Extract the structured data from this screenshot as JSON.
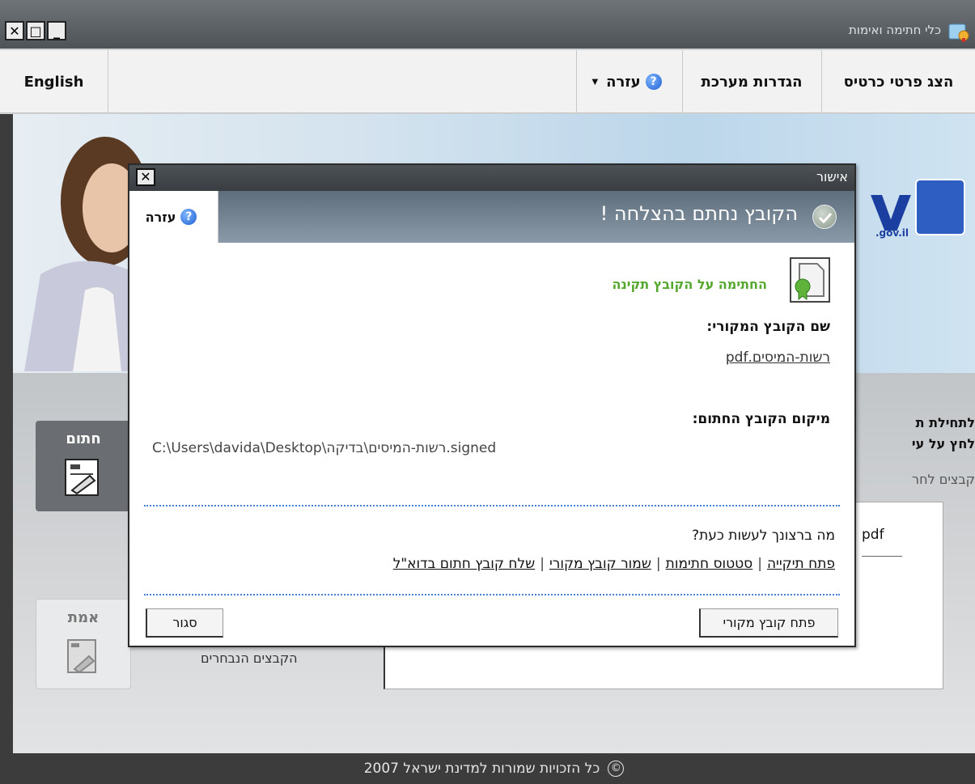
{
  "window": {
    "title": "כלי חתימה ואימות",
    "controls": {
      "close": "✕",
      "maximize": "□",
      "minimize": "_"
    }
  },
  "menu": {
    "card_details": "הצג פרטי כרטיס",
    "system_settings": "הגדרות מערכת",
    "help": "עזרה",
    "english": "English"
  },
  "banner": {
    "site_text": ".gov.il",
    "logo_letter": "v"
  },
  "side_buttons": {
    "sign": "חתום",
    "verify": "אמת"
  },
  "background": {
    "heading_line1": "לתחילת ת",
    "heading_line2": "לחץ על עי",
    "sub": "קבצים לחר",
    "file_item": "pdf",
    "selected_files_label": "הקבצים הנבחרים"
  },
  "dialog": {
    "title": "אישור",
    "header": "הקובץ נחתם בהצלחה !",
    "help": "עזרה",
    "valid_message": "החתימה על הקובץ תקינה",
    "original_label": "שם הקובץ המקורי:",
    "original_value": "רשות-המיסים.pdf",
    "location_label": "מיקום הקובץ החתום:",
    "location_value": "C:\\Users\\davida\\Desktop\\רשות-המיסים\\בדיקה.signed",
    "what_now": "מה ברצונך לעשות כעת?",
    "actions": [
      "פתח תיקייה",
      "סטטוס חתימות",
      "שמור קובץ מקורי",
      "שלח קובץ חתום בדוא\"ל"
    ],
    "action_separator": "|",
    "close_button": "סגור",
    "open_button": "פתח קובץ מקורי"
  },
  "footer": {
    "copyright_symbol": "©",
    "text": "כל הזכויות שמורות למדינת ישראל 2007"
  },
  "colors": {
    "valid_green": "#55a82e",
    "link_blue": "#4a80d4",
    "dark_bar": "#3c3c3c"
  }
}
